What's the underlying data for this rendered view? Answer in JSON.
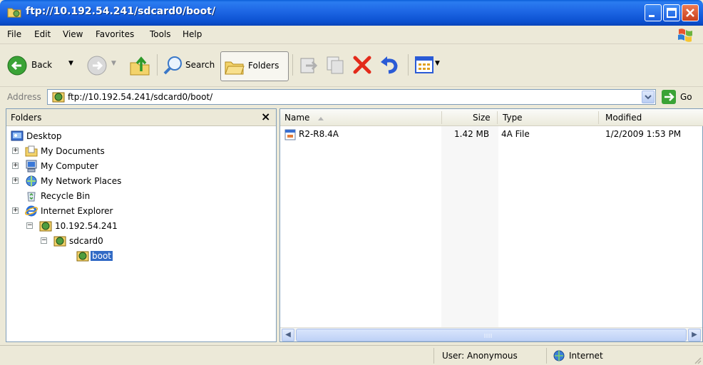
{
  "window": {
    "title": "ftp://10.192.54.241/sdcard0/boot/"
  },
  "menu": [
    "File",
    "Edit",
    "View",
    "Favorites",
    "Tools",
    "Help"
  ],
  "toolbar": {
    "back_label": "Back",
    "search_label": "Search",
    "folders_label": "Folders"
  },
  "address": {
    "label": "Address",
    "value": "ftp://10.192.54.241/sdcard0/boot/",
    "go_label": "Go"
  },
  "folders_pane": {
    "title": "Folders",
    "close": "×",
    "tree": [
      {
        "label": "Desktop",
        "icon": "desktop-icon"
      },
      {
        "label": "My Documents",
        "icon": "my-documents-icon",
        "expander": "+"
      },
      {
        "label": "My Computer",
        "icon": "my-computer-icon",
        "expander": "+"
      },
      {
        "label": "My Network Places",
        "icon": "network-places-icon",
        "expander": "+"
      },
      {
        "label": "Recycle Bin",
        "icon": "recycle-bin-icon"
      },
      {
        "label": "Internet Explorer",
        "icon": "internet-explorer-icon",
        "expander": "+"
      },
      {
        "label": "10.192.54.241",
        "icon": "ftp-server-icon",
        "expander": "−"
      },
      {
        "label": "sdcard0",
        "icon": "ftp-folder-icon",
        "expander": "−"
      },
      {
        "label": "boot",
        "icon": "ftp-folder-icon",
        "selected": true
      }
    ]
  },
  "file_list": {
    "columns": {
      "name": "Name",
      "size": "Size",
      "type": "Type",
      "modified": "Modified"
    },
    "rows": [
      {
        "name": "R2-R8.4A",
        "size": "1.42 MB",
        "type": "4A File",
        "modified": "1/2/2009 1:53 PM"
      }
    ]
  },
  "status": {
    "user": "User: Anonymous",
    "zone": "Internet"
  }
}
